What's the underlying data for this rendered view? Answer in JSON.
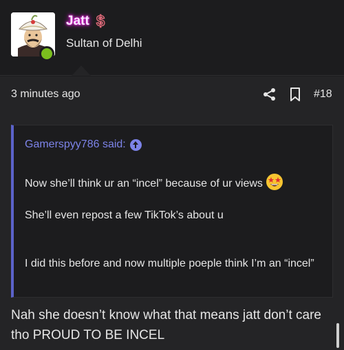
{
  "user": {
    "name": "Jatt",
    "badge_icon": "dollar-icon",
    "title": "Sultan of Delhi",
    "online_color": "#7bbf1e"
  },
  "post": {
    "time": "3 minutes ago",
    "number": "#18"
  },
  "quote": {
    "author_line": "Gamerspyy786 said:",
    "lines": [
      "Now she’ll think ur an “incel” because of ur views",
      "She’ll even repost a few TikTok’s about u",
      "I did this before and now multiple poeple think I’m an “incel”"
    ],
    "emoji": "star-struck-emoji"
  },
  "reply": {
    "text": "Nah she doesn’t know what that means jatt don’t care tho PROUD TO BE INCEL"
  },
  "colors": {
    "accent": "#7c83e8",
    "quote_bar": "#5b62c9",
    "username_glow": "#e01bd6"
  }
}
